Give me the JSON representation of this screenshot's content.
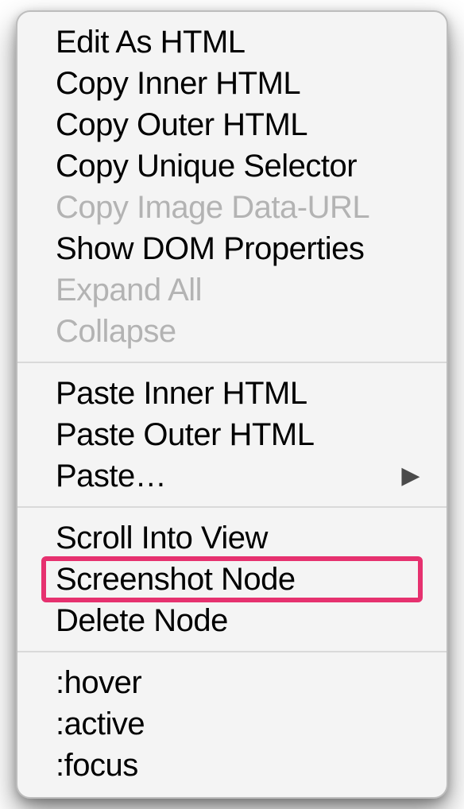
{
  "menu": {
    "groups": [
      {
        "items": [
          {
            "label": "Edit As HTML",
            "disabled": false,
            "submenu": false,
            "highlight": false
          },
          {
            "label": "Copy Inner HTML",
            "disabled": false,
            "submenu": false,
            "highlight": false
          },
          {
            "label": "Copy Outer HTML",
            "disabled": false,
            "submenu": false,
            "highlight": false
          },
          {
            "label": "Copy Unique Selector",
            "disabled": false,
            "submenu": false,
            "highlight": false
          },
          {
            "label": "Copy Image Data-URL",
            "disabled": true,
            "submenu": false,
            "highlight": false
          },
          {
            "label": "Show DOM Properties",
            "disabled": false,
            "submenu": false,
            "highlight": false
          },
          {
            "label": "Expand All",
            "disabled": true,
            "submenu": false,
            "highlight": false
          },
          {
            "label": "Collapse",
            "disabled": true,
            "submenu": false,
            "highlight": false
          }
        ]
      },
      {
        "items": [
          {
            "label": "Paste Inner HTML",
            "disabled": false,
            "submenu": false,
            "highlight": false
          },
          {
            "label": "Paste Outer HTML",
            "disabled": false,
            "submenu": false,
            "highlight": false
          },
          {
            "label": "Paste…",
            "disabled": false,
            "submenu": true,
            "highlight": false
          }
        ]
      },
      {
        "items": [
          {
            "label": "Scroll Into View",
            "disabled": false,
            "submenu": false,
            "highlight": false
          },
          {
            "label": "Screenshot Node",
            "disabled": false,
            "submenu": false,
            "highlight": true
          },
          {
            "label": "Delete Node",
            "disabled": false,
            "submenu": false,
            "highlight": false
          }
        ]
      },
      {
        "items": [
          {
            "label": ":hover",
            "disabled": false,
            "submenu": false,
            "highlight": false
          },
          {
            "label": ":active",
            "disabled": false,
            "submenu": false,
            "highlight": false
          },
          {
            "label": ":focus",
            "disabled": false,
            "submenu": false,
            "highlight": false
          }
        ]
      }
    ]
  }
}
